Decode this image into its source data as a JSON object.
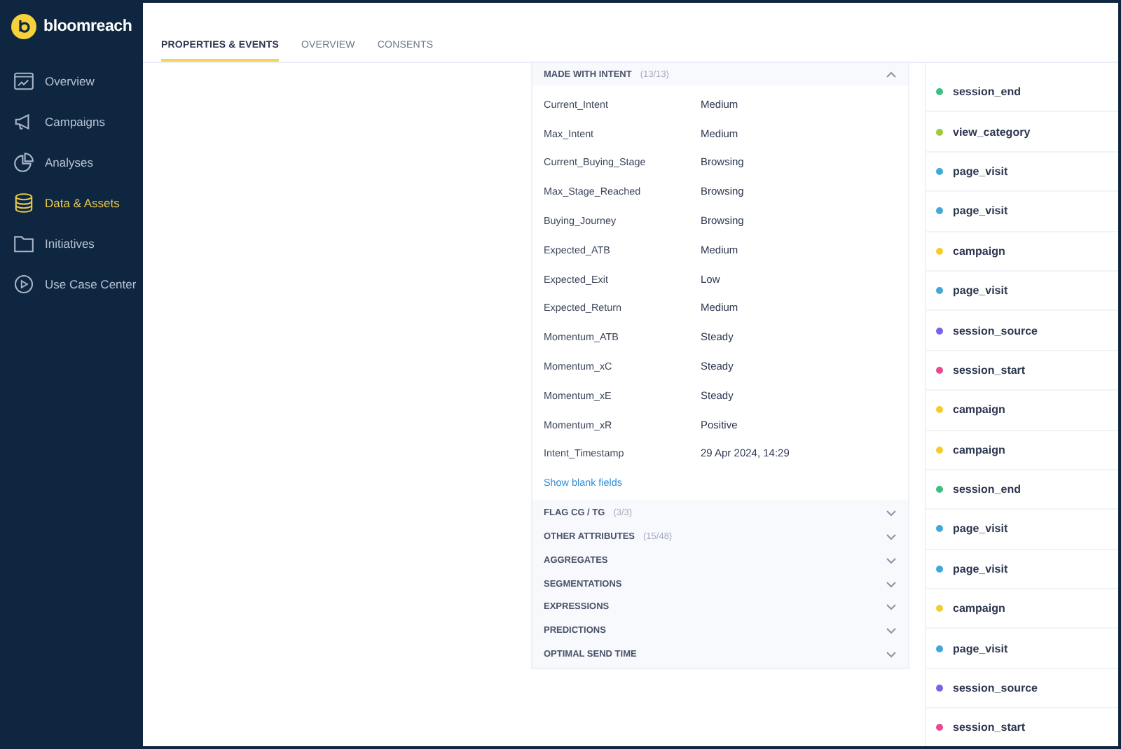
{
  "brand": {
    "name": "bloomreach"
  },
  "sidebar": {
    "items": [
      {
        "label": "Overview",
        "selected": false
      },
      {
        "label": "Campaigns",
        "selected": false
      },
      {
        "label": "Analyses",
        "selected": false
      },
      {
        "label": "Data & Assets",
        "selected": true
      },
      {
        "label": "Initiatives",
        "selected": false
      },
      {
        "label": "Use Case Center",
        "selected": false
      }
    ]
  },
  "tabs": [
    {
      "label": "PROPERTIES & EVENTS",
      "selected": true
    },
    {
      "label": "OVERVIEW",
      "selected": false
    },
    {
      "label": "CONSENTS",
      "selected": false
    }
  ],
  "sections": [
    {
      "title": "MADE WITH INTENT",
      "count": "(13/13)",
      "expanded": true,
      "properties": [
        {
          "name": "Current_Intent",
          "value": "Medium"
        },
        {
          "name": "Max_Intent",
          "value": "Medium"
        },
        {
          "name": "Current_Buying_Stage",
          "value": "Browsing"
        },
        {
          "name": "Max_Stage_Reached",
          "value": "Browsing"
        },
        {
          "name": "Buying_Journey",
          "value": "Browsing"
        },
        {
          "name": "Expected_ATB",
          "value": "Medium"
        },
        {
          "name": "Expected_Exit",
          "value": "Low"
        },
        {
          "name": "Expected_Return",
          "value": "Medium"
        },
        {
          "name": "Momentum_ATB",
          "value": "Steady"
        },
        {
          "name": "Momentum_xC",
          "value": "Steady"
        },
        {
          "name": "Momentum_xE",
          "value": "Steady"
        },
        {
          "name": "Momentum_xR",
          "value": "Positive"
        },
        {
          "name": "Intent_Timestamp",
          "value": "29 Apr 2024, 14:29"
        }
      ],
      "link": "Show blank fields"
    },
    {
      "title": "FLAG CG / TG",
      "count": "(3/3)",
      "expanded": false
    },
    {
      "title": "OTHER ATTRIBUTES",
      "count": "(15/48)",
      "expanded": false
    },
    {
      "title": "AGGREGATES",
      "expanded": false
    },
    {
      "title": "SEGMENTATIONS",
      "expanded": false
    },
    {
      "title": "EXPRESSIONS",
      "expanded": false
    },
    {
      "title": "PREDICTIONS",
      "expanded": false
    },
    {
      "title": "OPTIMAL SEND TIME",
      "expanded": false
    }
  ],
  "events": [
    {
      "name": "session_end",
      "color": "#3dbf7f"
    },
    {
      "name": "view_category",
      "color": "#9ccc3a"
    },
    {
      "name": "page_visit",
      "color": "#3fa9d9"
    },
    {
      "name": "page_visit",
      "color": "#3fa9d9"
    },
    {
      "name": "campaign",
      "color": "#f5cc2e"
    },
    {
      "name": "page_visit",
      "color": "#3fa9d9"
    },
    {
      "name": "session_source",
      "color": "#7b61e8"
    },
    {
      "name": "session_start",
      "color": "#e84a8c"
    },
    {
      "name": "campaign",
      "color": "#f5cc2e"
    },
    {
      "name": "campaign",
      "color": "#f5cc2e"
    },
    {
      "name": "session_end",
      "color": "#3dbf7f"
    },
    {
      "name": "page_visit",
      "color": "#3fa9d9"
    },
    {
      "name": "page_visit",
      "color": "#3fa9d9"
    },
    {
      "name": "campaign",
      "color": "#f5cc2e"
    },
    {
      "name": "page_visit",
      "color": "#3fa9d9"
    },
    {
      "name": "session_source",
      "color": "#7b61e8"
    },
    {
      "name": "session_start",
      "color": "#e84a8c"
    }
  ]
}
